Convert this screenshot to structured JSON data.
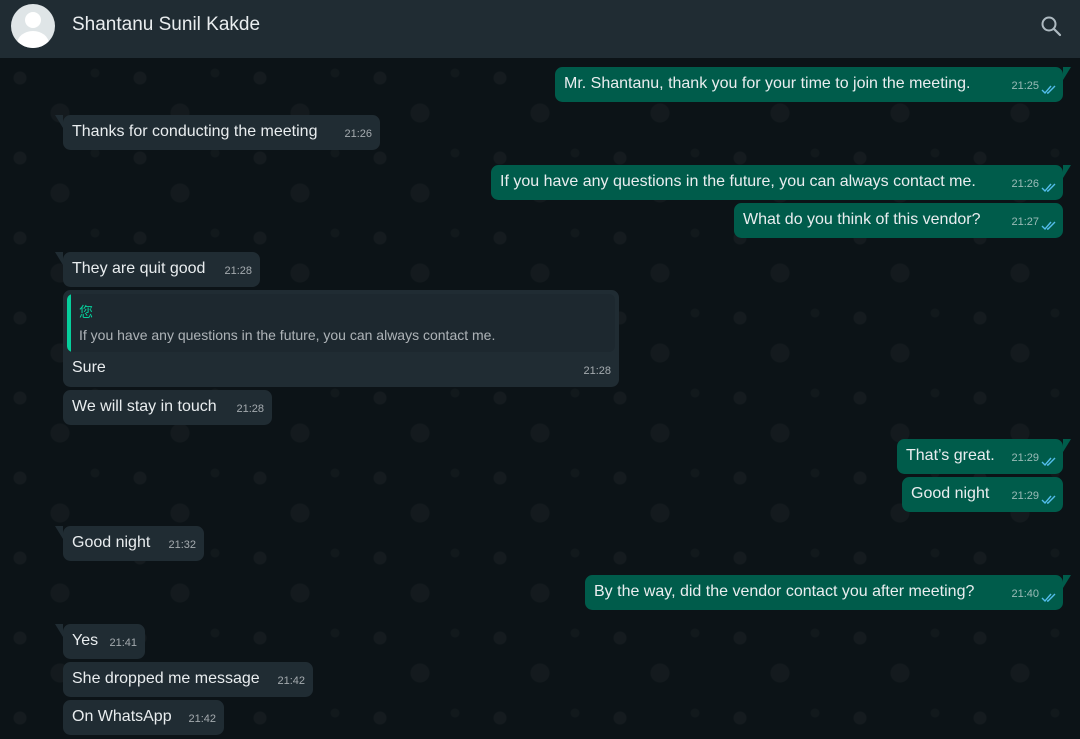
{
  "header": {
    "contact_name": "Shantanu Sunil Kakde"
  },
  "messages": [
    {
      "dir": "out",
      "text": "Mr. Shantanu, thank you for your time to join the meeting.",
      "time": "21:25"
    },
    {
      "dir": "in",
      "text": "Thanks for conducting the meeting",
      "time": "21:26"
    },
    {
      "dir": "out",
      "text": "If you have any questions in the future, you can always contact me.",
      "time": "21:26"
    },
    {
      "dir": "out",
      "text": "What do you think of this vendor?",
      "time": "21:27"
    },
    {
      "dir": "in",
      "text": "They are quit good",
      "time": "21:28"
    },
    {
      "dir": "in",
      "text": "Sure",
      "time": "21:28",
      "quote": {
        "author": "您",
        "text": "If you have any questions in the future, you can always contact me."
      }
    },
    {
      "dir": "in",
      "text": "We will stay in touch",
      "time": "21:28"
    },
    {
      "dir": "out",
      "text": "That’s great.",
      "time": "21:29"
    },
    {
      "dir": "out",
      "text": "Good night",
      "time": "21:29"
    },
    {
      "dir": "in",
      "text": "Good night",
      "time": "21:32"
    },
    {
      "dir": "out",
      "text": "By the way, did the vendor contact you after meeting?",
      "time": "21:40"
    },
    {
      "dir": "in",
      "text": "Yes",
      "time": "21:41"
    },
    {
      "dir": "in",
      "text": "She dropped me message",
      "time": "21:42"
    },
    {
      "dir": "in",
      "text": "On WhatsApp",
      "time": "21:42"
    }
  ],
  "colors": {
    "header_bg": "#202c33",
    "incoming_bubble": "#202c33",
    "outgoing_bubble": "#005c4b",
    "read_ticks": "#53bdeb",
    "quote_accent": "#06cf9c"
  },
  "icons": [
    "search-icon",
    "double-check-icon",
    "avatar"
  ]
}
